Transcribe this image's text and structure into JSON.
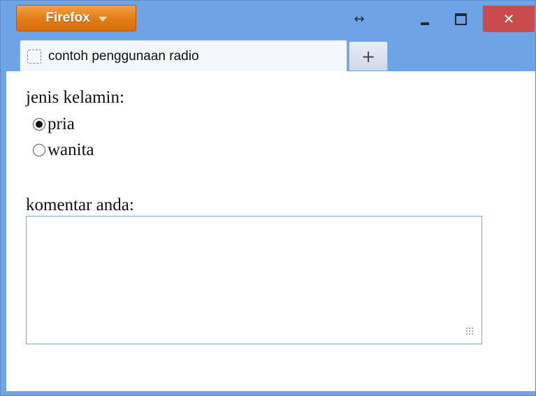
{
  "titlebar": {
    "app_button_label": "Firefox",
    "resize_glyph": "↔",
    "close_glyph": "✕"
  },
  "tabs": [
    {
      "label": "contoh penggunaan radio",
      "active": true
    }
  ],
  "newtab": {
    "glyph": "+"
  },
  "form": {
    "gender_label": "jenis kelamin:",
    "options": [
      {
        "label": "pria",
        "checked": true
      },
      {
        "label": "wanita",
        "checked": false
      }
    ],
    "comment_label": "komentar anda:",
    "comment_value": ""
  },
  "colors": {
    "firefox_orange": "#e27a16",
    "frame_blue": "#6ea4e6",
    "close_red": "#c94b4b"
  }
}
